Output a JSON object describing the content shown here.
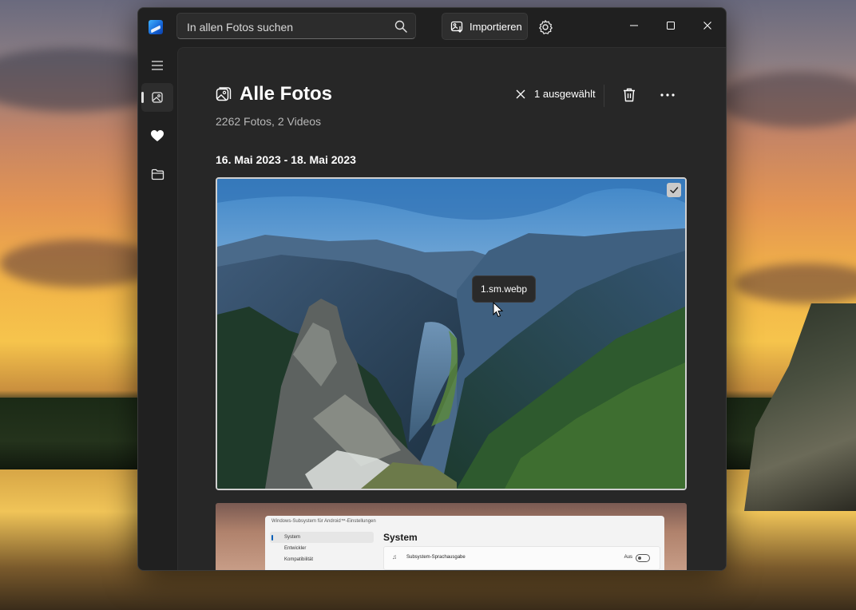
{
  "window": {
    "search_placeholder": "In allen Fotos suchen",
    "import_label": "Importieren"
  },
  "sidebar": {
    "items": [
      {
        "name": "menu",
        "icon": "hamburger-icon"
      },
      {
        "name": "all-photos",
        "icon": "photos-icon",
        "active": true
      },
      {
        "name": "favorites",
        "icon": "heart-icon"
      },
      {
        "name": "folders",
        "icon": "folder-icon"
      }
    ]
  },
  "header": {
    "title": "Alle Fotos",
    "subtitle": "2262 Fotos, 2 Videos",
    "selection_label": "1 ausgewählt"
  },
  "gallery": {
    "date_range": "16. Mai 2023 - 18. Mai 2023",
    "photo_tooltip": "1.sm.webp",
    "selected": true
  },
  "screenshot_thumb": {
    "window_title": "Windows-Subsystem für Android™-Einstellungen",
    "nav": [
      "System",
      "Entwickler",
      "Kompatibilität"
    ],
    "heading": "System",
    "row_label": "Subsystem-Sprachausgabe",
    "row_value": "Aus"
  },
  "colors": {
    "window_bg": "#202020",
    "content_bg": "#272727",
    "accent": "#005fb8"
  }
}
